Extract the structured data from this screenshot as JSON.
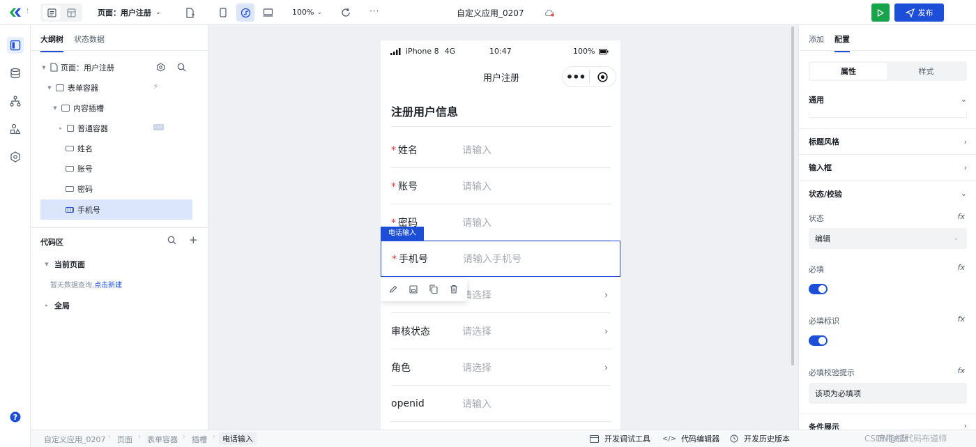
{
  "topbar": {
    "page_selector": "页面：用户注册",
    "zoom": "100%",
    "more": "···",
    "app_title": "自定义应用_0207",
    "publish_label": "发布"
  },
  "outline": {
    "tab_tree": "大纲树",
    "tab_state": "状态数据",
    "nodes": [
      {
        "label": "页面：用户注册"
      },
      {
        "label": "表单容器"
      },
      {
        "label": "内容插槽"
      },
      {
        "label": "普通容器"
      },
      {
        "label": "姓名"
      },
      {
        "label": "账号"
      },
      {
        "label": "密码"
      },
      {
        "label": "手机号"
      }
    ],
    "ref_badge": "CLS"
  },
  "code": {
    "title": "代码区",
    "current_page": "当前页面",
    "empty_text": "暂无数据查询,",
    "create_link": "点击新建",
    "global": "全局"
  },
  "phone": {
    "carrier": "iPhone 8",
    "network": "4G",
    "time": "10:47",
    "battery": "100%",
    "nav_title": "用户注册",
    "form_title": "注册用户信息",
    "selected_tag": "电话输入",
    "fields": [
      {
        "label": "姓名",
        "placeholder": "请输入",
        "required": "*"
      },
      {
        "label": "账号",
        "placeholder": "请输入",
        "required": "*"
      },
      {
        "label": "密码",
        "placeholder": "请输入",
        "required": "*"
      },
      {
        "label": "手机号",
        "placeholder": "请输入手机号",
        "required": "*"
      },
      {
        "label": "",
        "placeholder": "请选择"
      },
      {
        "label": "审核状态",
        "placeholder": "请选择"
      },
      {
        "label": "角色",
        "placeholder": "请选择"
      },
      {
        "label": "openid",
        "placeholder": "请输入"
      }
    ]
  },
  "config": {
    "tab_add": "添加",
    "tab_config": "配置",
    "seg_props": "属性",
    "seg_style": "样式",
    "sections": {
      "general": "通用",
      "title_style": "标题风格",
      "input_box": "输入框",
      "state_validation": "状态/校验",
      "conditional": "条件展示"
    },
    "state_label": "状态",
    "state_value": "编辑",
    "required_label": "必填",
    "required_mark_label": "必填标识",
    "required_hint_label": "必填校验提示",
    "required_hint_value": "该项为必填项",
    "fx": "fx"
  },
  "bottom": {
    "breadcrumb": [
      "自定义应用_0207",
      "页面",
      "表单容器",
      "插槽",
      "电话输入"
    ],
    "tools": [
      "开发调试工具",
      "代码编辑器",
      "开发历史版本"
    ],
    "watermark": "CSDN@低代码布道师",
    "apply_text": "应用主题"
  },
  "colors": {
    "accent": "#1d4ed8",
    "run": "#16a34a"
  }
}
